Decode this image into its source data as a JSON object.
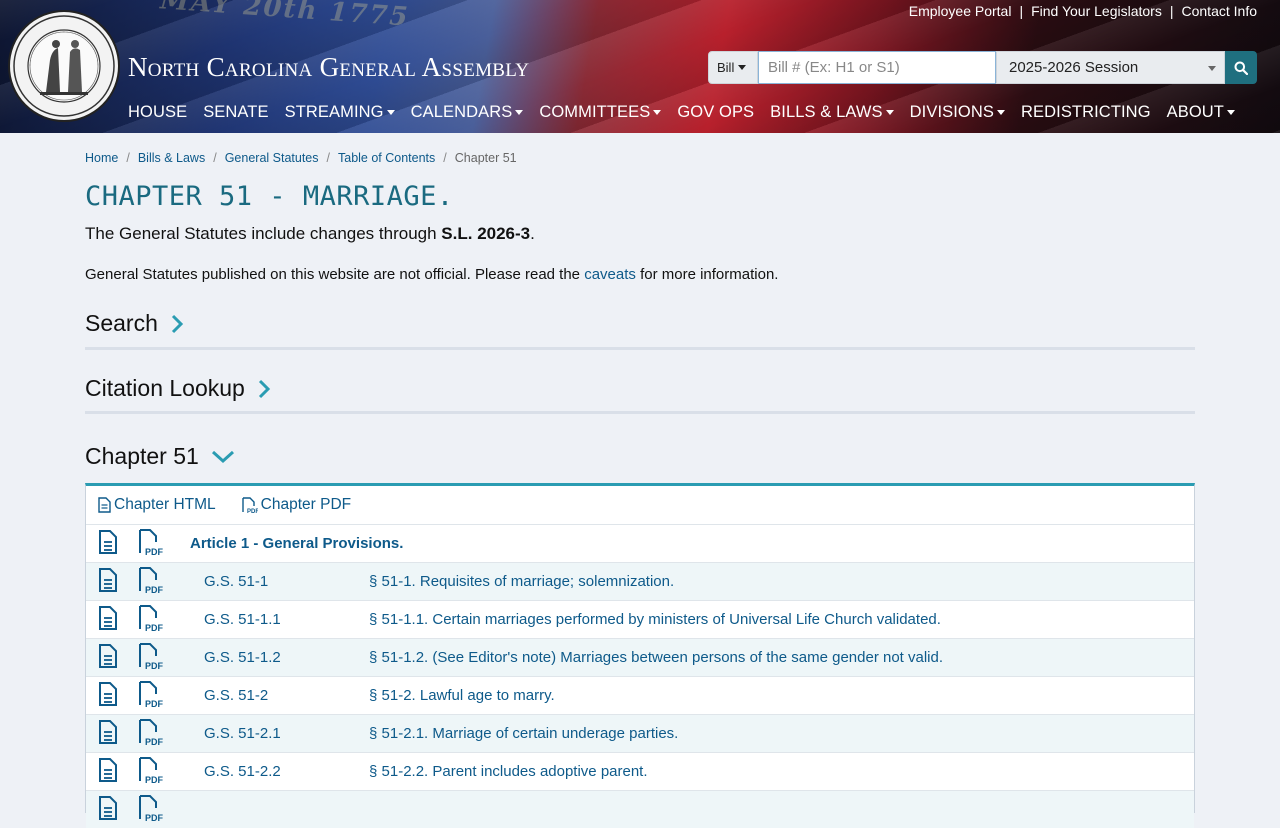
{
  "header": {
    "site_title": "North Carolina General Assembly",
    "banner_text": "MAY 20th 1775",
    "seal_text": "THE GREAT SEAL OF THE STATE OF NORTH CAROLINA",
    "top_links": [
      "Employee Portal",
      "Find Your Legislators",
      "Contact Info"
    ],
    "search": {
      "type_label": "Bill",
      "placeholder": "Bill # (Ex: H1 or S1)",
      "session": "2025-2026 Session"
    },
    "nav": [
      {
        "label": "HOUSE",
        "dropdown": false
      },
      {
        "label": "SENATE",
        "dropdown": false
      },
      {
        "label": "STREAMING",
        "dropdown": true
      },
      {
        "label": "CALENDARS",
        "dropdown": true
      },
      {
        "label": "COMMITTEES",
        "dropdown": true
      },
      {
        "label": "GOV OPS",
        "dropdown": false
      },
      {
        "label": "BILLS & LAWS",
        "dropdown": true
      },
      {
        "label": "DIVISIONS",
        "dropdown": true
      },
      {
        "label": "REDISTRICTING",
        "dropdown": false
      },
      {
        "label": "ABOUT",
        "dropdown": true
      }
    ]
  },
  "breadcrumb": [
    "Home",
    "Bills & Laws",
    "General Statutes",
    "Table of Contents",
    "Chapter 51"
  ],
  "page": {
    "title": "CHAPTER 51 - MARRIAGE.",
    "changes_prefix": "The General Statutes include changes through ",
    "changes_law": "S.L. 2026-3",
    "changes_suffix": ".",
    "disclaimer_prefix": "General Statutes published on this website are not official. Please read the ",
    "disclaimer_link": "caveats",
    "disclaimer_suffix": " for more information."
  },
  "sections": {
    "search": "Search",
    "citation": "Citation Lookup",
    "chapter": "Chapter 51"
  },
  "panel": {
    "html_label": "Chapter HTML",
    "pdf_label": "Chapter PDF",
    "article": "Article 1 - General Provisions.",
    "rows": [
      {
        "gs": "G.S. 51-1",
        "section": "§ 51-1. Requisites of marriage; solemnization."
      },
      {
        "gs": "G.S. 51-1.1",
        "section": "§ 51-1.1. Certain marriages performed by ministers of Universal Life Church validated."
      },
      {
        "gs": "G.S. 51-1.2",
        "section": "§ 51-1.2. (See Editor's note) Marriages between persons of the same gender not valid."
      },
      {
        "gs": "G.S. 51-2",
        "section": "§ 51-2. Lawful age to marry."
      },
      {
        "gs": "G.S. 51-2.1",
        "section": "§ 51-2.1. Marriage of certain underage parties."
      },
      {
        "gs": "G.S. 51-2.2",
        "section": "§ 51-2.2. Parent includes adoptive parent."
      },
      {
        "gs": "",
        "section": ""
      }
    ]
  },
  "colors": {
    "accent": "#1a6a80",
    "link": "#0e5a8a",
    "search_button": "#1f6f7f",
    "panel_border": "#2a9cb2"
  }
}
